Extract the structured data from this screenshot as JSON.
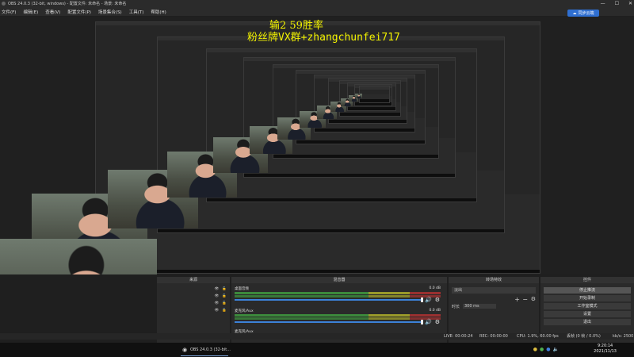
{
  "window": {
    "title": "OBS 24.0.3 (32-bit, windows) - 配置文件: 未命名 - 场景: 未命名",
    "min": "—",
    "max": "☐",
    "close": "✕"
  },
  "menu": [
    "文件(F)",
    "编辑(E)",
    "查看(V)",
    "配置文件(P)",
    "场景集合(S)",
    "工具(T)",
    "帮助(H)"
  ],
  "sync_button": "同步云端",
  "overlay": {
    "line1": "输2    59胜率",
    "line2": "粉丝牌VX群+zhangchunfei717"
  },
  "docks": {
    "sources": {
      "title": "来源"
    },
    "mixer": {
      "title": "混音器",
      "tracks": [
        {
          "name": "桌面音频",
          "db": "0.0 dB"
        },
        {
          "name": "麦克风/Aux",
          "db": "0.0 dB"
        }
      ],
      "third_label": "麦克风/Aux"
    },
    "transitions": {
      "title": "转场特效",
      "mode": "淡出",
      "duration_label": "时长",
      "duration": "300 ms"
    },
    "controls": {
      "title": "控件",
      "buttons": [
        "停止推流",
        "开始录制",
        "工作室模式",
        "设置",
        "退出"
      ]
    }
  },
  "status": {
    "live": "LIVE: 00:00:24",
    "rec": "REC: 00:00:00",
    "cpu": "CPU: 1.9%, 60.00 fps",
    "network": "丢帧 (0 帧 / 0.0%)",
    "kbps": "kb/s: 2500"
  },
  "taskbar": {
    "obs_label": "OBS 24.0.3 (32-bit...",
    "time": "9:20:14",
    "date": "2021/11/13"
  },
  "icons": [
    "eye-icon",
    "lock-icon",
    "speaker-icon",
    "gear-icon",
    "plus-icon",
    "minus-icon"
  ]
}
